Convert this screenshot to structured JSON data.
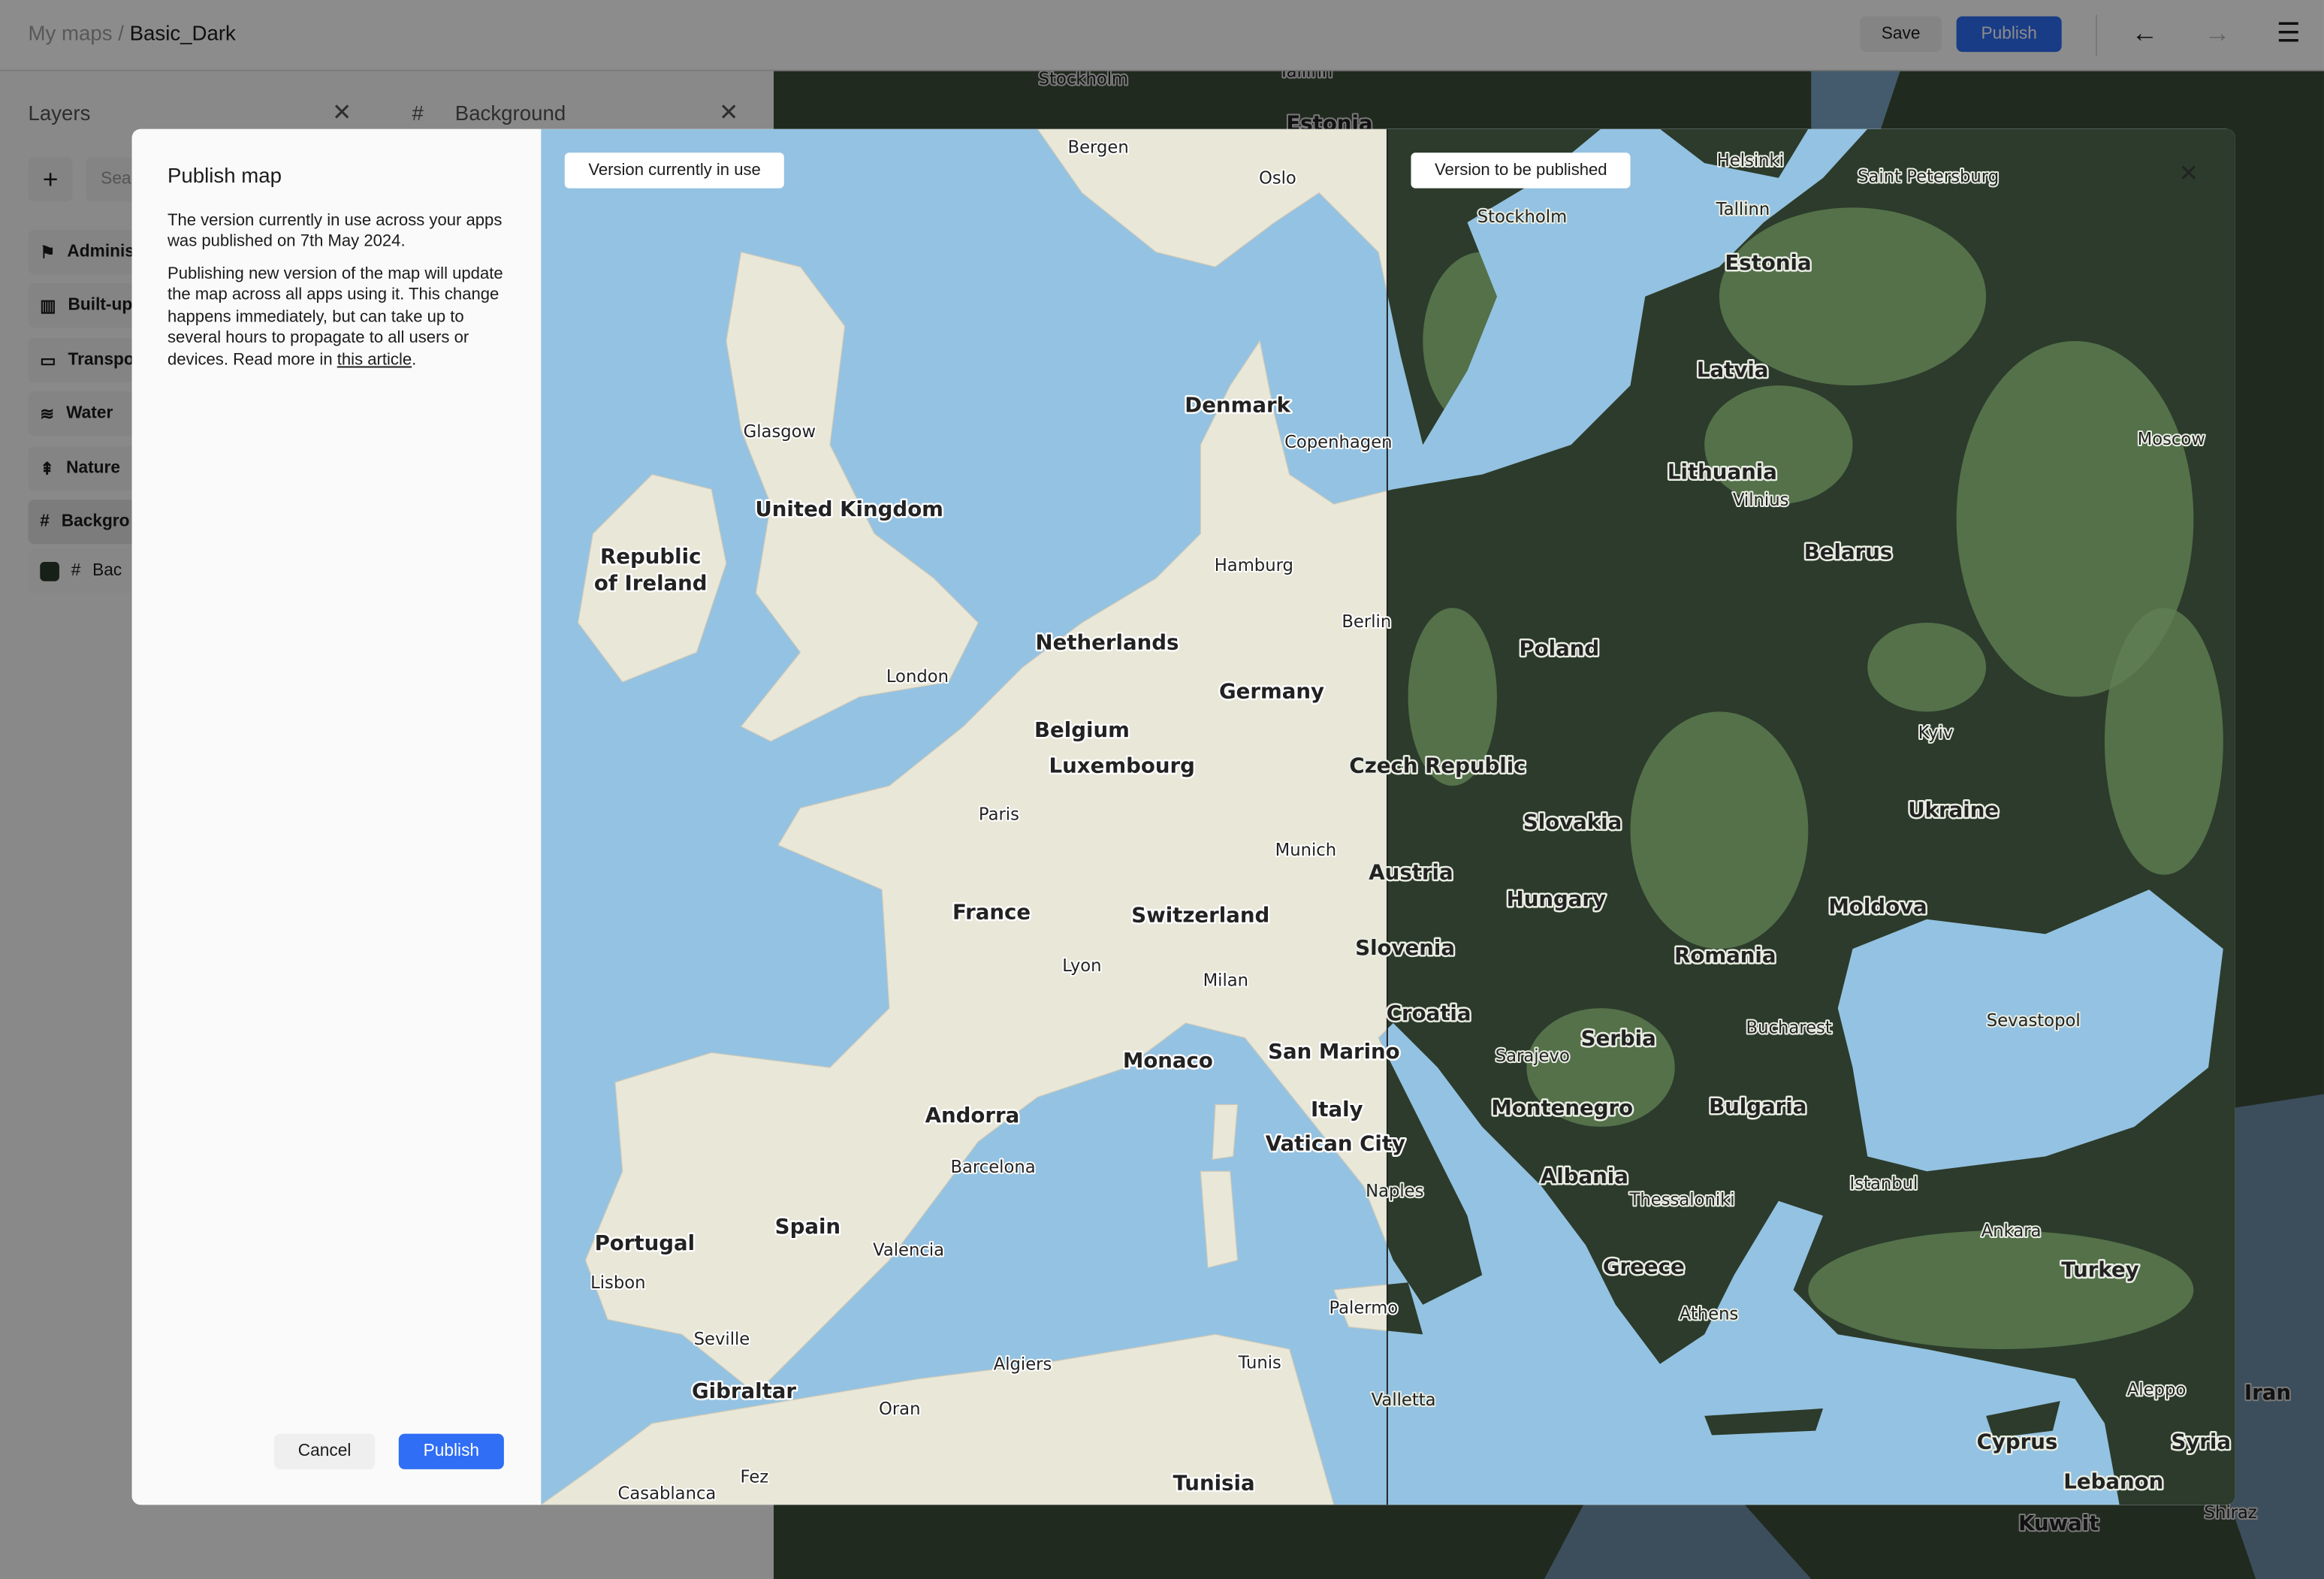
{
  "header": {
    "breadcrumb_root": "My maps",
    "breadcrumb_sep": "/",
    "map_name": "Basic_Dark",
    "save_label": "Save",
    "publish_label": "Publish"
  },
  "layers_panel": {
    "title": "Layers",
    "search_placeholder": "Sea",
    "items": [
      {
        "label": "Adminis",
        "icon": "flag-icon"
      },
      {
        "label": "Built-up",
        "icon": "building-icon"
      },
      {
        "label": "Transpo",
        "icon": "bus-icon"
      },
      {
        "label": "Water",
        "icon": "water-icon"
      },
      {
        "label": "Nature",
        "icon": "trees-icon"
      },
      {
        "label": "Backgro",
        "icon": "hash-icon",
        "selected": true
      }
    ],
    "sub_item": {
      "label": "Bac",
      "swatch_color": "#2b3a2e"
    }
  },
  "detail_panel": {
    "title": "Background"
  },
  "modal": {
    "title": "Publish map",
    "para1": "The version currently in use across your apps was published on 7th May 2024.",
    "para2": "Publishing new version of the map will update the map across all apps using it. This change happens immediately, but can take up to several hours to propagate to all users or devices. Read more in ",
    "link": "this article",
    "para2_end": ".",
    "cancel_label": "Cancel",
    "publish_label": "Publish",
    "left_tag": "Version currently in use",
    "right_tag": "Version to be published"
  },
  "colors": {
    "accent": "#2f6ef5",
    "water": "#94c2e2",
    "land_light": "#e9e7d8",
    "land_dark": "#2c3b2b",
    "forest": "#5f7f52"
  },
  "map_labels_left": [
    "Bergen",
    "Oslo",
    "Glasgow",
    "Denmark",
    "Copenhagen",
    "United Kingdom",
    "Republic",
    "of Ireland",
    "Hamburg",
    "Berlin",
    "Netherlands",
    "London",
    "Germany",
    "Belgium",
    "Luxembourg",
    "Paris",
    "Munich",
    "France",
    "Switzerland",
    "Lyon",
    "Milan",
    "Monaco",
    "San Marino",
    "Italy",
    "Andorra",
    "Vatican City",
    "Barcelona",
    "Portugal",
    "Spain",
    "Valencia",
    "Lisbon",
    "Seville",
    "Palermo",
    "Algiers",
    "Tunis",
    "Gibraltar",
    "Oran",
    "Fez",
    "Casablanca",
    "Tunisia"
  ],
  "map_labels_right": [
    "Helsinki",
    "Saint Petersburg",
    "Stockholm",
    "Tallinn",
    "Estonia",
    "Latvia",
    "Moscow",
    "Lithuania",
    "Vilnius",
    "Belarus",
    "Poland",
    "Kyiv",
    "Czech Republic",
    "Ukraine",
    "Slovakia",
    "Austria",
    "Hungary",
    "Moldova",
    "Slovenia",
    "Romania",
    "Croatia",
    "Sevastopol",
    "Bucharest",
    "Serbia",
    "Sarajevo",
    "Montenegro",
    "Bulgaria",
    "Albania",
    "Istanbul",
    "Thessaloniki",
    "Naples",
    "Ankara",
    "Greece",
    "Turkey",
    "Athens",
    "Valletta",
    "Aleppo",
    "Cyprus",
    "Syria",
    "Lebanon"
  ],
  "background_labels": [
    "Stockholm",
    "Tallinn",
    "Estonia",
    "Iran",
    "Kuwait",
    "Shiraz"
  ]
}
